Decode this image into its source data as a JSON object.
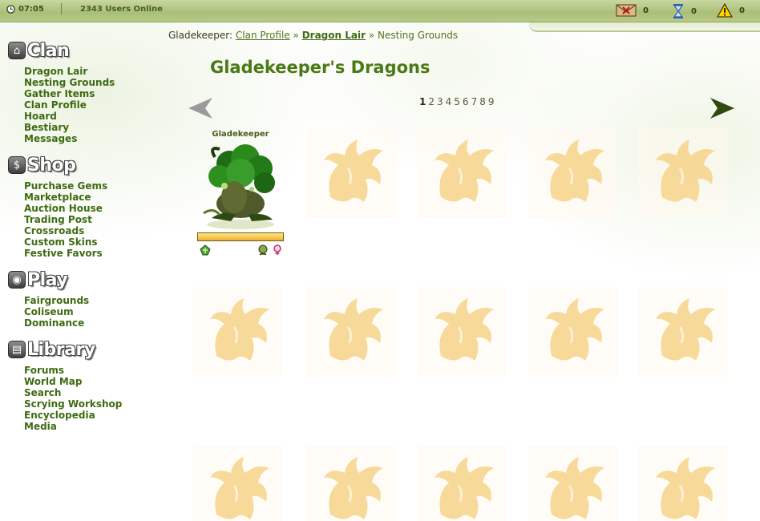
{
  "topbar": {
    "time": "07:05",
    "users_online": "2343 Users Online",
    "mail_count": "0",
    "hourglass_count": "0",
    "alert_count": "0"
  },
  "sidebar": {
    "sections": [
      {
        "title": "Clan",
        "icon": "home-icon",
        "items": [
          "Dragon Lair",
          "Nesting Grounds",
          "Gather Items",
          "Clan Profile",
          "Hoard",
          "Bestiary",
          "Messages"
        ]
      },
      {
        "title": "Shop",
        "icon": "shop-icon",
        "items": [
          "Purchase Gems",
          "Marketplace",
          "Auction House",
          "Trading Post",
          "Crossroads",
          "Custom Skins",
          "Festive Favors"
        ]
      },
      {
        "title": "Play",
        "icon": "play-icon",
        "items": [
          "Fairgrounds",
          "Coliseum",
          "Dominance"
        ]
      },
      {
        "title": "Library",
        "icon": "book-icon",
        "items": [
          "Forums",
          "World Map",
          "Search",
          "Scrying Workshop",
          "Encyclopedia",
          "Media"
        ]
      }
    ]
  },
  "breadcrumb": {
    "owner": "Gladekeeper:",
    "clan_profile": "Clan Profile",
    "sep": "»",
    "dragon_lair": "Dragon Lair",
    "nesting_grounds": "Nesting Grounds"
  },
  "title": "Gladekeeper's Dragons",
  "pager": {
    "pages": [
      "1",
      "2",
      "3",
      "4",
      "5",
      "6",
      "7",
      "8",
      "9"
    ],
    "current": "1"
  },
  "dragon": {
    "name": "Gladekeeper",
    "energy_fraction": 1.0
  },
  "colors": {
    "accent": "#4a7a16",
    "link": "#3e6b12",
    "slot_placeholder": "#f6d48a"
  }
}
